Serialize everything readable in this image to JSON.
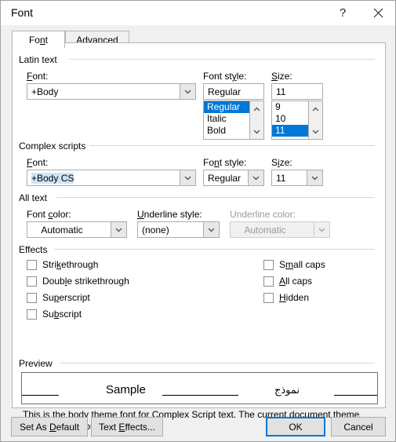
{
  "window": {
    "title": "Font",
    "help_label": "?",
    "close_icon": "close-icon"
  },
  "tabs": [
    {
      "label_pre": "Fo",
      "label_accel": "n",
      "label_post": "t",
      "active": true
    },
    {
      "label_pre": "Ad",
      "label_accel": "v",
      "label_post": "anced",
      "active": false
    }
  ],
  "groups": {
    "latin": {
      "title": "Latin text",
      "font": {
        "label_pre": "",
        "label_accel": "F",
        "label_post": "ont:",
        "value": "+Body"
      },
      "font_style": {
        "label_pre": "Font st",
        "label_accel": "y",
        "label_post": "le:",
        "value": "Regular",
        "options": [
          "Regular",
          "Italic",
          "Bold"
        ],
        "selected": "Regular"
      },
      "size": {
        "label_pre": "",
        "label_accel": "S",
        "label_post": "ize:",
        "value": "11",
        "options": [
          "9",
          "10",
          "11"
        ],
        "selected": "11"
      }
    },
    "complex": {
      "title": "Complex scripts",
      "font": {
        "label_pre": "",
        "label_accel": "F",
        "label_post": "ont:",
        "value": "+Body CS"
      },
      "font_style": {
        "label_pre": "Fo",
        "label_accel": "n",
        "label_post": "t style:",
        "value": "Regular"
      },
      "size": {
        "label_pre": "S",
        "label_accel": "i",
        "label_post": "ze:",
        "value": "11"
      }
    },
    "alltext": {
      "title": "All text",
      "font_color": {
        "label_pre": "Font ",
        "label_accel": "c",
        "label_post": "olor:",
        "value": "Automatic"
      },
      "underline_style": {
        "label_pre": "",
        "label_accel": "U",
        "label_post": "nderline style:",
        "value": "(none)"
      },
      "underline_color": {
        "label": "Underline color:",
        "value": "Automatic",
        "disabled": true
      }
    },
    "effects": {
      "title": "Effects",
      "left": [
        {
          "pre": "Stri",
          "accel": "k",
          "post": "ethrough",
          "checked": false
        },
        {
          "pre": "Doub",
          "accel": "l",
          "post": "e strikethrough",
          "checked": false
        },
        {
          "pre": "Su",
          "accel": "p",
          "post": "erscript",
          "checked": false
        },
        {
          "pre": "Su",
          "accel": "b",
          "post": "script",
          "checked": false
        }
      ],
      "right": [
        {
          "pre": "S",
          "accel": "m",
          "post": "all caps",
          "checked": false
        },
        {
          "pre": "",
          "accel": "A",
          "post": "ll caps",
          "checked": false
        },
        {
          "pre": "",
          "accel": "H",
          "post": "idden",
          "checked": false
        }
      ]
    },
    "preview": {
      "title": "Preview",
      "sample_latin": "Sample",
      "sample_complex": "نموذج"
    }
  },
  "description": "This is the body theme font for Complex Script text. The current document theme defines which font will be used.",
  "buttons": {
    "set_as_default": {
      "pre": "Set As ",
      "accel": "D",
      "post": "efault"
    },
    "text_effects": {
      "pre": "Text ",
      "accel": "E",
      "post": "ffects..."
    },
    "ok": "OK",
    "cancel": "Cancel"
  },
  "colors": {
    "accent": "#0078d7",
    "selection_text": "#cce4f7",
    "dialog_bg": "#f0f0f0",
    "panel_bg": "#ffffff",
    "disabled_text": "#9a9a9a"
  }
}
